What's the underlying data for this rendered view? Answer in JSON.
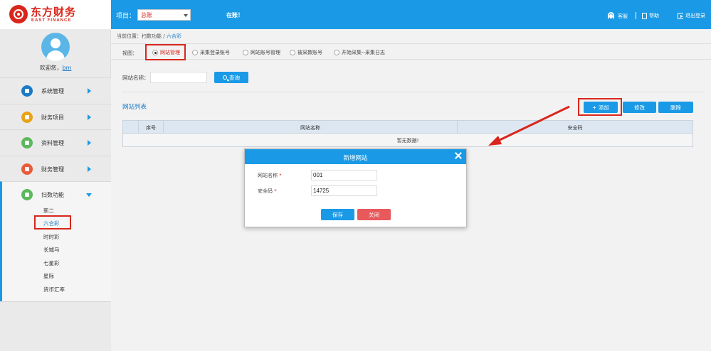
{
  "header": {
    "logo_cn": "东方财务",
    "logo_en": "EAST FINANCE",
    "project_label": "项目：",
    "project_value": "总账",
    "title": "在账！",
    "service": "客服",
    "help": "帮助",
    "logout": "退出登录"
  },
  "sidebar": {
    "welcome_prefix": "欢迎您，",
    "user": "bm",
    "items": [
      {
        "label": "系统管理",
        "color": "#1a7bc8",
        "icon": "gear-icon"
      },
      {
        "label": "财务项目",
        "color": "#e8a317",
        "icon": "briefcase-icon"
      },
      {
        "label": "资料管理",
        "color": "#5cb85c",
        "icon": "folder-icon"
      },
      {
        "label": "财务管理",
        "color": "#e85c3a",
        "icon": "document-icon"
      },
      {
        "label": "扫数功能",
        "color": "#5cb85c",
        "icon": "monitor-icon"
      }
    ],
    "sub_items": [
      "新二",
      "六合彩",
      "时时彩",
      "长城马",
      "七星彩",
      "星际",
      "货币汇率"
    ]
  },
  "breadcrumb": {
    "prefix": "当前位置：扫数功能 /",
    "current": "六合彩"
  },
  "view": {
    "label": "视图：",
    "options": [
      "网站管理",
      "采集登录账号",
      "网站账号管理",
      "被采数账号",
      "开始采集--采集日志"
    ],
    "selected": "网站管理"
  },
  "search": {
    "label": "网站名称：",
    "value": "",
    "button": "查询"
  },
  "list": {
    "title": "网站列表",
    "add": "+ 添加",
    "edit": "修改",
    "delete": "删除",
    "columns": [
      "序号",
      "网站名称",
      "安全码"
    ],
    "empty": "暂无数据!"
  },
  "dialog": {
    "title": "新增网站",
    "name_label": "网站名称",
    "name_value": "001",
    "code_label": "安全码",
    "code_value": "14725",
    "required_mark": "*",
    "save": "保存",
    "close": "关闭"
  },
  "colors": {
    "primary": "#1a9ae6",
    "highlight": "#d9261c",
    "close_button": "#e8595c"
  }
}
